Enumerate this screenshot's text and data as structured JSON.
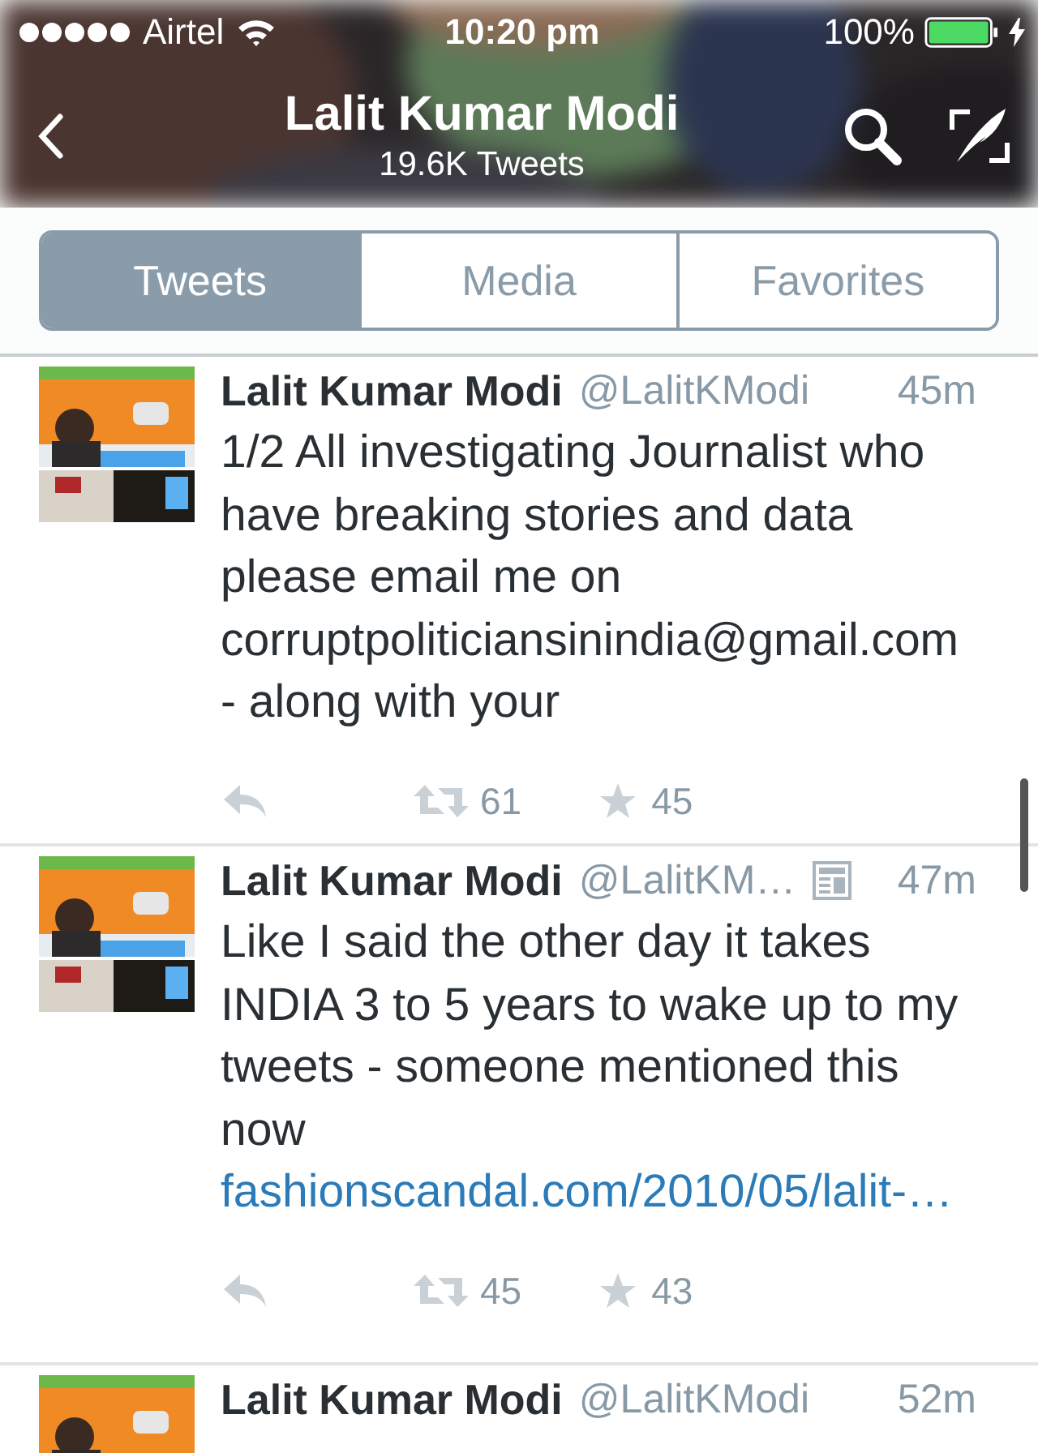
{
  "status_bar": {
    "carrier": "Airtel",
    "time": "10:20 pm",
    "battery": "100%",
    "charging": true
  },
  "nav": {
    "title": "Lalit Kumar Modi",
    "subtitle": "19.6K Tweets"
  },
  "tabs": [
    {
      "label": "Tweets",
      "selected": true
    },
    {
      "label": "Media",
      "selected": false
    },
    {
      "label": "Favorites",
      "selected": false
    }
  ],
  "tweets": [
    {
      "name": "Lalit Kumar Modi",
      "handle": "@LalitKModi",
      "card": false,
      "time": "45m",
      "text": "1/2 All investigating Journalist who have breaking stories and data please email me on corruptpoliticiansinindia@gmail.com - along with your",
      "retweets": "61",
      "favorites": "45"
    },
    {
      "name": "Lalit Kumar Modi",
      "handle": "@LalitKM…",
      "card": true,
      "time": "47m",
      "text": "Like I said the other day it takes INDIA 3 to 5 years to wake up to my tweets - someone mentioned this now",
      "link": "fashionscandal.com/2010/05/lalit-…",
      "retweets": "45",
      "favorites": "43"
    },
    {
      "name": "Lalit Kumar Modi",
      "handle": "@LalitKModi",
      "card": false,
      "time": "52m"
    }
  ]
}
